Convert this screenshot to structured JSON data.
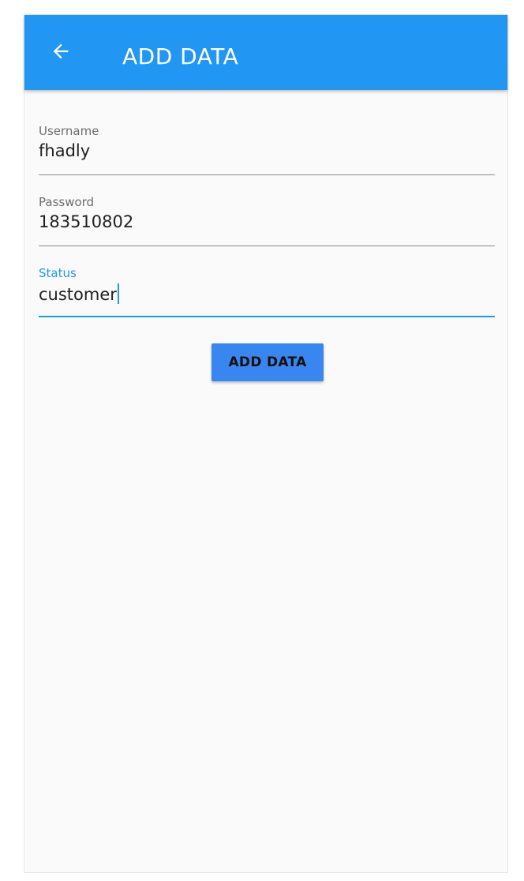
{
  "app_bar": {
    "title": "ADD DATA",
    "back_icon": "arrow-left-icon",
    "color": "#2196f3"
  },
  "form": {
    "username": {
      "label": "Username",
      "value": "fhadly"
    },
    "password": {
      "label": "Password",
      "value": "183510802"
    },
    "status": {
      "label": "Status",
      "value": "customer",
      "focused": true
    }
  },
  "submit_button": {
    "label": "ADD DATA",
    "color": "#3a86f0"
  }
}
